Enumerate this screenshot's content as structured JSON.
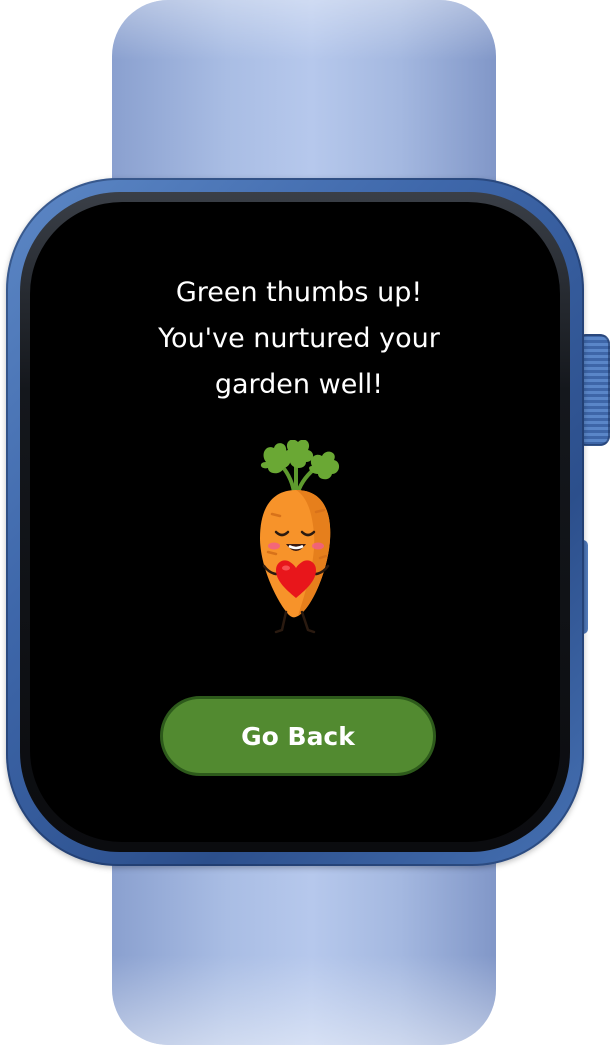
{
  "screen": {
    "message_lines": [
      "Green thumbs up!",
      "You've nurtured your",
      "garden well!"
    ],
    "illustration": "happy-carrot-holding-heart",
    "button_label": "Go Back"
  },
  "device": {
    "type": "smartwatch",
    "case_color": "#3e67aa",
    "band_color": "#a9bde4"
  },
  "colors": {
    "screen_background": "#000000",
    "text": "#ffffff",
    "button_fill": "#528a30",
    "button_border": "#2d5a1b",
    "carrot_orange": "#f7932a",
    "leaf_green": "#6aa834",
    "heart_red": "#e8161b"
  }
}
